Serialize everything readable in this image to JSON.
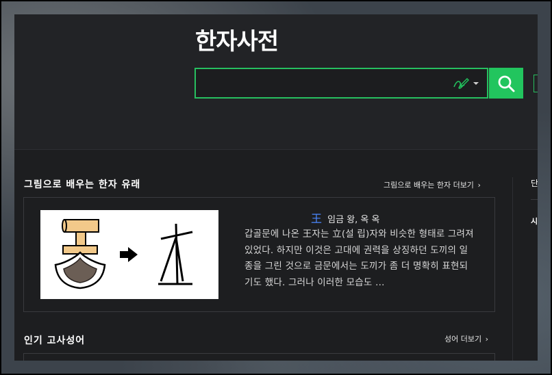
{
  "app": {
    "title": "한자사전"
  },
  "search": {
    "value": "",
    "placeholder": "",
    "handwrite_icon": "handwriting-icon",
    "dropdown_icon": "caret-down-icon",
    "button_icon": "search-icon",
    "accent_color": "#22c55e"
  },
  "etymology": {
    "section_title": "그림으로 배우는 한자 유래",
    "more_label": "그림으로 배우는 한자 더보기",
    "hanja_char": "王",
    "hanja_meaning": "임금 왕, 옥 옥",
    "description": "갑골문에 나온 王자는 立(설 립)자와 비슷한 형태로 그려져 있었다. 하지만 이것은 고대에 권력을 상징하던 도끼의 일종을 그린 것으로 금문에서는 도끼가 좀 더 명확히 표현되기도 했다. 그러나 이러한 모습도 …"
  },
  "idioms": {
    "section_title": "인기 고사성어",
    "more_label": "성어 더보기"
  },
  "right_panel": {
    "tab1": "단",
    "tab2": "시"
  }
}
